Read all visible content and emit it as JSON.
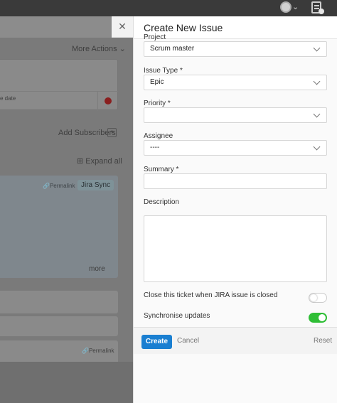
{
  "background_page": {
    "more_actions": "More Actions",
    "due_date_fragment": "e date",
    "add_subscribers": "Add Subscribers",
    "expand_all": "Expand all",
    "permalink": "Permalink",
    "jira_sync": "Jira Sync",
    "more": "more",
    "permalink_2": "Permalink"
  },
  "panel": {
    "title": "Create New Issue",
    "fields": {
      "project": {
        "label": "Project",
        "value": "Scrum master"
      },
      "issue_type": {
        "label": "Issue Type *",
        "value": "Epic"
      },
      "priority": {
        "label": "Priority *",
        "value": ""
      },
      "assignee": {
        "label": "Assignee",
        "value": "----"
      },
      "summary": {
        "label": "Summary *",
        "value": ""
      },
      "description": {
        "label": "Description",
        "value": ""
      }
    },
    "toggles": {
      "close_ticket": {
        "label": "Close this ticket when JIRA issue is closed",
        "on": false
      },
      "synchronise": {
        "label": "Synchronise updates",
        "on": true
      }
    },
    "buttons": {
      "create": "Create",
      "cancel": "Cancel",
      "reset": "Reset"
    }
  },
  "colors": {
    "primary": "#1a7fd1",
    "toggle_on": "#2fbe36"
  }
}
